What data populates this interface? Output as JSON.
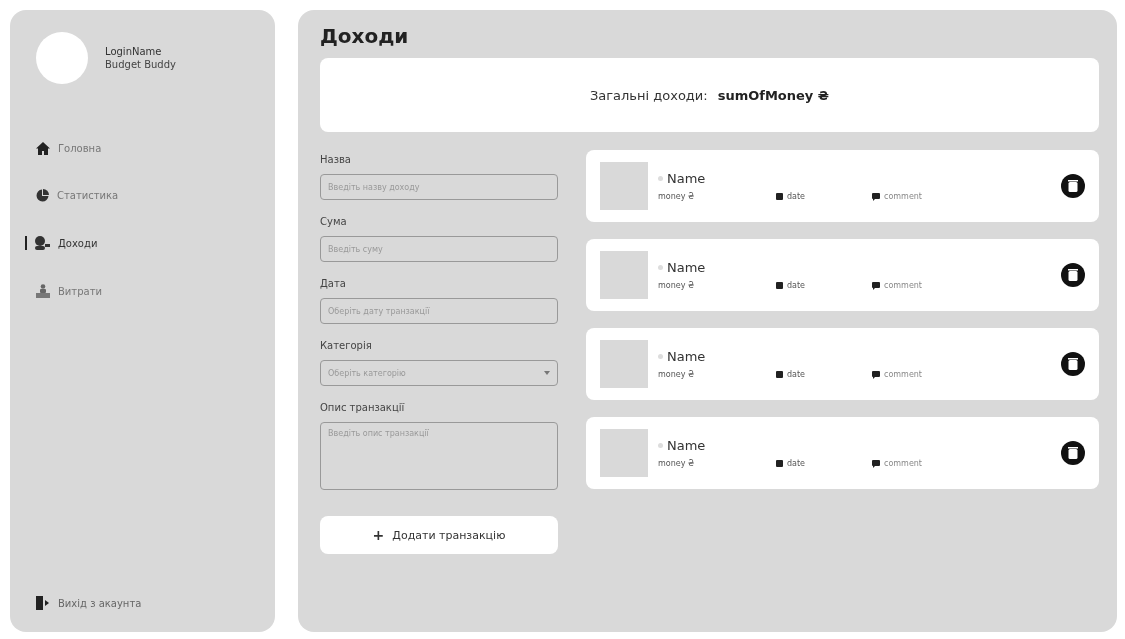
{
  "profile": {
    "login": "LoginName",
    "app": "Budget Buddy"
  },
  "nav": [
    {
      "label": "Головна",
      "kind": "home",
      "selected": false
    },
    {
      "label": "Статистика",
      "kind": "stats",
      "selected": false
    },
    {
      "label": "Доходи",
      "kind": "income",
      "selected": true
    },
    {
      "label": "Витрати",
      "kind": "expense",
      "selected": false
    }
  ],
  "logout": "Вихід з акаунта",
  "page_title": "Доходи",
  "summary": {
    "label": "Загальні доходи:",
    "value": "sumOfMoney",
    "currency": "₴"
  },
  "form": {
    "fields": [
      {
        "kind": "input",
        "label": "Назва",
        "placeholder": "Введіть назву доходу"
      },
      {
        "kind": "input",
        "label": "Сума",
        "placeholder": "Введіть суму"
      },
      {
        "kind": "input",
        "label": "Дата",
        "placeholder": "Оберіть дату транзакції"
      },
      {
        "kind": "select",
        "label": "Категорія",
        "placeholder": "Оберіть категорію"
      },
      {
        "kind": "textarea",
        "label": "Опис транзакції",
        "placeholder": "Введіть опис транзакції"
      }
    ],
    "submit": {
      "icon": "+",
      "label": "Додати транзакцію"
    }
  },
  "transactions": [
    {
      "name": "Name",
      "money": "money ₴",
      "date": "date",
      "comment": "comment"
    },
    {
      "name": "Name",
      "money": "money ₴",
      "date": "date",
      "comment": "comment"
    },
    {
      "name": "Name",
      "money": "money ₴",
      "date": "date",
      "comment": "comment"
    },
    {
      "name": "Name",
      "money": "money ₴",
      "date": "date",
      "comment": "comment"
    }
  ]
}
